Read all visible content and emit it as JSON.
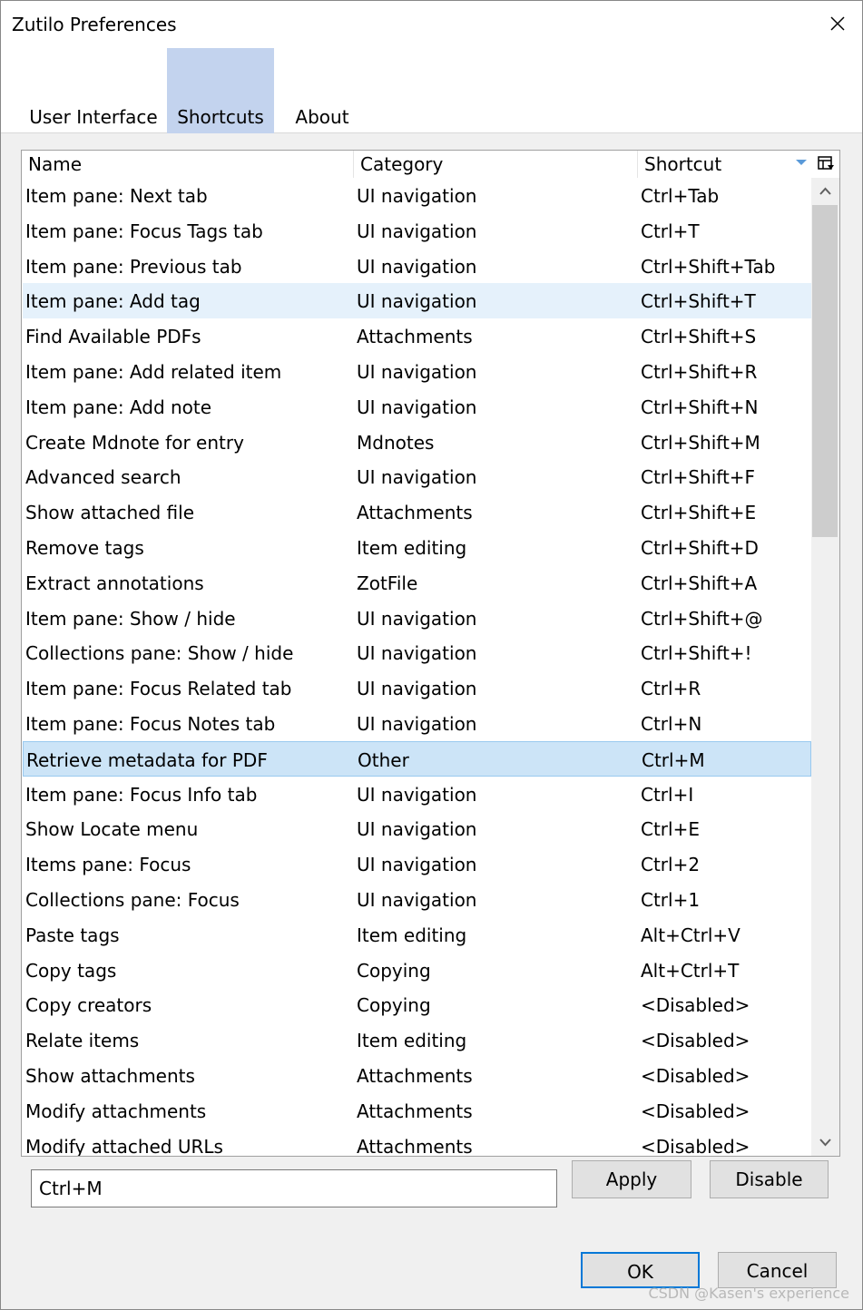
{
  "window": {
    "title": "Zutilo Preferences"
  },
  "tabs": [
    {
      "label": "User Interface",
      "active": false
    },
    {
      "label": "Shortcuts",
      "active": true
    },
    {
      "label": "About",
      "active": false
    }
  ],
  "table": {
    "columns": [
      "Name",
      "Category",
      "Shortcut"
    ],
    "sorted_column": "Shortcut",
    "rows": [
      {
        "name": "Item pane: Next tab",
        "category": "UI navigation",
        "shortcut": "Ctrl+Tab"
      },
      {
        "name": "Item pane: Focus Tags tab",
        "category": "UI navigation",
        "shortcut": "Ctrl+T"
      },
      {
        "name": "Item pane: Previous tab",
        "category": "UI navigation",
        "shortcut": "Ctrl+Shift+Tab"
      },
      {
        "name": "Item pane: Add tag",
        "category": "UI navigation",
        "shortcut": "Ctrl+Shift+T"
      },
      {
        "name": "Find Available PDFs",
        "category": "Attachments",
        "shortcut": "Ctrl+Shift+S"
      },
      {
        "name": "Item pane: Add related item",
        "category": "UI navigation",
        "shortcut": "Ctrl+Shift+R"
      },
      {
        "name": "Item pane: Add note",
        "category": "UI navigation",
        "shortcut": "Ctrl+Shift+N"
      },
      {
        "name": "Create Mdnote for entry",
        "category": "Mdnotes",
        "shortcut": "Ctrl+Shift+M"
      },
      {
        "name": "Advanced search",
        "category": "UI navigation",
        "shortcut": "Ctrl+Shift+F"
      },
      {
        "name": "Show attached file",
        "category": "Attachments",
        "shortcut": "Ctrl+Shift+E"
      },
      {
        "name": "Remove tags",
        "category": "Item editing",
        "shortcut": "Ctrl+Shift+D"
      },
      {
        "name": "Extract annotations",
        "category": "ZotFile",
        "shortcut": "Ctrl+Shift+A"
      },
      {
        "name": "Item pane: Show / hide",
        "category": "UI navigation",
        "shortcut": "Ctrl+Shift+@"
      },
      {
        "name": "Collections pane: Show / hide",
        "category": "UI navigation",
        "shortcut": "Ctrl+Shift+!"
      },
      {
        "name": "Item pane: Focus Related tab",
        "category": "UI navigation",
        "shortcut": "Ctrl+R"
      },
      {
        "name": "Item pane: Focus Notes tab",
        "category": "UI navigation",
        "shortcut": "Ctrl+N"
      },
      {
        "name": "Retrieve metadata for PDF",
        "category": "Other",
        "shortcut": "Ctrl+M"
      },
      {
        "name": "Item pane: Focus Info tab",
        "category": "UI navigation",
        "shortcut": "Ctrl+I"
      },
      {
        "name": "Show Locate menu",
        "category": "UI navigation",
        "shortcut": "Ctrl+E"
      },
      {
        "name": "Items pane: Focus",
        "category": "UI navigation",
        "shortcut": "Ctrl+2"
      },
      {
        "name": "Collections pane: Focus",
        "category": "UI navigation",
        "shortcut": "Ctrl+1"
      },
      {
        "name": "Paste tags",
        "category": "Item editing",
        "shortcut": "Alt+Ctrl+V"
      },
      {
        "name": "Copy tags",
        "category": "Copying",
        "shortcut": "Alt+Ctrl+T"
      },
      {
        "name": "Copy creators",
        "category": "Copying",
        "shortcut": "<Disabled>"
      },
      {
        "name": "Relate items",
        "category": "Item editing",
        "shortcut": "<Disabled>"
      },
      {
        "name": "Show attachments",
        "category": "Attachments",
        "shortcut": "<Disabled>"
      },
      {
        "name": "Modify attachments",
        "category": "Attachments",
        "shortcut": "<Disabled>"
      },
      {
        "name": "Modify attached URLs",
        "category": "Attachments",
        "shortcut": "<Disabled>"
      }
    ],
    "hover_row": 3,
    "selected_row": 16
  },
  "editor": {
    "value": "Ctrl+M",
    "apply_label": "Apply",
    "disable_label": "Disable"
  },
  "dialog_buttons": {
    "ok_label": "OK",
    "cancel_label": "Cancel"
  },
  "watermark": "CSDN @Kasen's experience",
  "colors": {
    "active_tab": "#c3d3ee",
    "selected_row": "#cce4f7",
    "hover_row": "#e5f1fb",
    "default_button_border": "#0078d7"
  }
}
